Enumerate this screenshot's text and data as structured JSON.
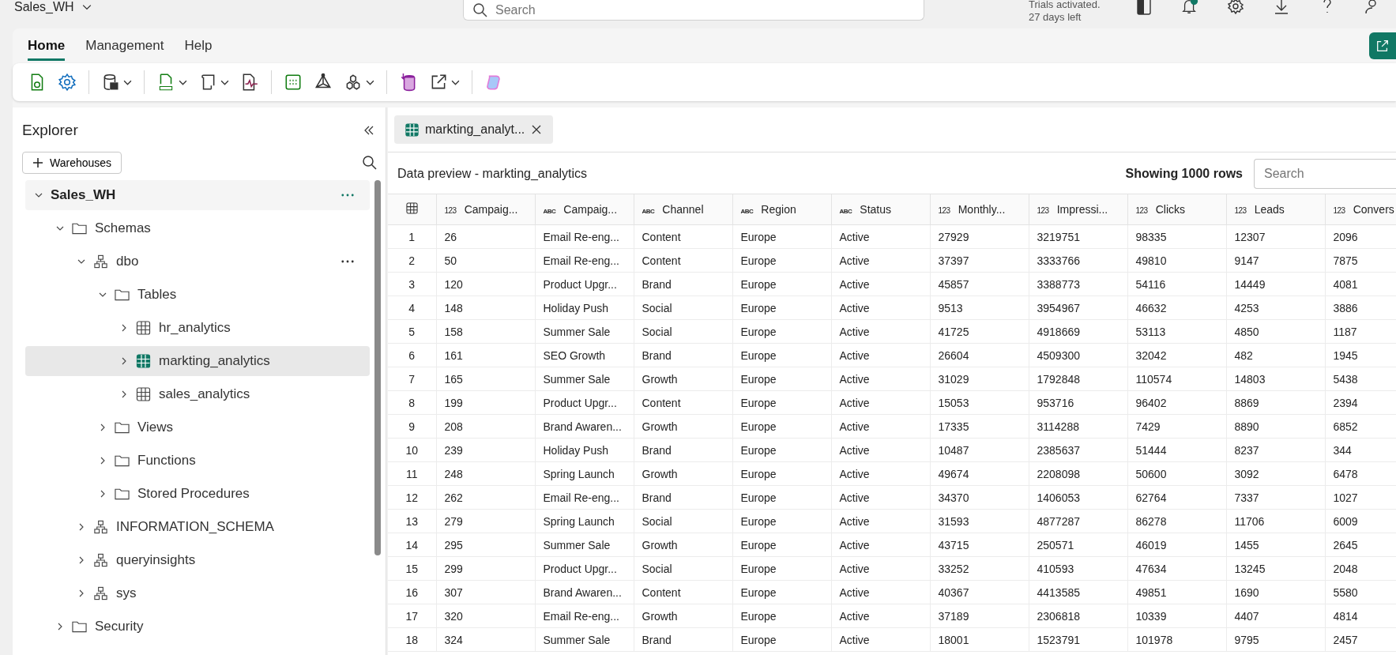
{
  "header": {
    "workspace": "Sales_WH",
    "search_placeholder": "Search",
    "trial_lines": [
      "Trials activated.",
      "27 days left"
    ],
    "notifications_badge": true
  },
  "ribbon_tabs": [
    {
      "label": "Home",
      "selected": true
    },
    {
      "label": "Management",
      "selected": false
    },
    {
      "label": "Help",
      "selected": false
    }
  ],
  "toolbar": [
    [
      {
        "kind": "refresh",
        "dropdown": false
      },
      {
        "kind": "settings",
        "dropdown": false
      }
    ],
    [
      {
        "kind": "database",
        "dropdown": true
      }
    ],
    [
      {
        "kind": "sql",
        "dropdown": true
      },
      {
        "kind": "script",
        "dropdown": true
      },
      {
        "kind": "report",
        "dropdown": false
      }
    ],
    [
      {
        "kind": "grid",
        "dropdown": false
      },
      {
        "kind": "model",
        "dropdown": false
      },
      {
        "kind": "shapes",
        "dropdown": true
      }
    ],
    [
      {
        "kind": "import",
        "dropdown": false
      },
      {
        "kind": "export",
        "dropdown": true
      }
    ],
    [
      {
        "kind": "copilot",
        "dropdown": false
      }
    ]
  ],
  "explorer": {
    "title": "Explorer",
    "add_button": "Warehouses",
    "tree": [
      {
        "label": "Sales_WH",
        "kind": "warehouse",
        "expanded": true,
        "selected": false,
        "menu": true,
        "children": [
          {
            "label": "Schemas",
            "kind": "folder",
            "expanded": true,
            "selected": false,
            "menu": false,
            "children": [
              {
                "label": "dbo",
                "kind": "schema",
                "expanded": true,
                "selected": false,
                "menu": true,
                "children": [
                  {
                    "label": "Tables",
                    "kind": "folder",
                    "expanded": true,
                    "selected": false,
                    "menu": false,
                    "children": [
                      {
                        "label": "hr_analytics",
                        "kind": "table",
                        "expanded": false,
                        "selected": false,
                        "menu": false
                      },
                      {
                        "label": "markting_analytics",
                        "kind": "table",
                        "expanded": false,
                        "selected": true,
                        "menu": false
                      },
                      {
                        "label": "sales_analytics",
                        "kind": "table",
                        "expanded": false,
                        "selected": false,
                        "menu": false
                      }
                    ]
                  },
                  {
                    "label": "Views",
                    "kind": "folder",
                    "expanded": false,
                    "selected": false,
                    "menu": false
                  },
                  {
                    "label": "Functions",
                    "kind": "folder",
                    "expanded": false,
                    "selected": false,
                    "menu": false
                  },
                  {
                    "label": "Stored Procedures",
                    "kind": "folder",
                    "expanded": false,
                    "selected": false,
                    "menu": false
                  }
                ]
              },
              {
                "label": "INFORMATION_SCHEMA",
                "kind": "schema",
                "expanded": false,
                "selected": false,
                "menu": false
              },
              {
                "label": "queryinsights",
                "kind": "schema",
                "expanded": false,
                "selected": false,
                "menu": false
              },
              {
                "label": "sys",
                "kind": "schema",
                "expanded": false,
                "selected": false,
                "menu": false
              }
            ]
          },
          {
            "label": "Security",
            "kind": "folder",
            "expanded": false,
            "selected": false,
            "menu": false
          }
        ]
      }
    ]
  },
  "editor_tabs": [
    {
      "label": "markting_analyt...",
      "selected": true
    }
  ],
  "preview": {
    "title": "Data preview - markting_analytics",
    "row_count": "Showing 1000 rows",
    "search_placeholder": "Search",
    "columns": [
      {
        "type": "123",
        "label": "Campaig..."
      },
      {
        "type": "ABC",
        "label": "Campaig..."
      },
      {
        "type": "ABC",
        "label": "Channel"
      },
      {
        "type": "ABC",
        "label": "Region"
      },
      {
        "type": "ABC",
        "label": "Status"
      },
      {
        "type": "123",
        "label": "Monthly..."
      },
      {
        "type": "123",
        "label": "Impressi..."
      },
      {
        "type": "123",
        "label": "Clicks"
      },
      {
        "type": "123",
        "label": "Leads"
      },
      {
        "type": "123",
        "label": "Convers"
      }
    ],
    "rows": [
      {
        "number": "1",
        "cells": [
          "26",
          "Email Re-eng...",
          "Content",
          "Europe",
          "Active",
          "27929",
          "3219751",
          "98335",
          "12307",
          "2096"
        ]
      },
      {
        "number": "2",
        "cells": [
          "50",
          "Email Re-eng...",
          "Content",
          "Europe",
          "Active",
          "37397",
          "3333766",
          "49810",
          "9147",
          "7875"
        ]
      },
      {
        "number": "3",
        "cells": [
          "120",
          "Product Upgr...",
          "Brand",
          "Europe",
          "Active",
          "45857",
          "3388773",
          "54116",
          "14449",
          "4081"
        ]
      },
      {
        "number": "4",
        "cells": [
          "148",
          "Holiday Push",
          "Social",
          "Europe",
          "Active",
          "9513",
          "3954967",
          "46632",
          "4253",
          "3886"
        ]
      },
      {
        "number": "5",
        "cells": [
          "158",
          "Summer Sale",
          "Social",
          "Europe",
          "Active",
          "41725",
          "4918669",
          "53113",
          "4850",
          "1187"
        ]
      },
      {
        "number": "6",
        "cells": [
          "161",
          "SEO Growth",
          "Brand",
          "Europe",
          "Active",
          "26604",
          "4509300",
          "32042",
          "482",
          "1945"
        ]
      },
      {
        "number": "7",
        "cells": [
          "165",
          "Summer Sale",
          "Growth",
          "Europe",
          "Active",
          "31029",
          "1792848",
          "110574",
          "14803",
          "5438"
        ]
      },
      {
        "number": "8",
        "cells": [
          "199",
          "Product Upgr...",
          "Content",
          "Europe",
          "Active",
          "15053",
          "953716",
          "96402",
          "8869",
          "2394"
        ]
      },
      {
        "number": "9",
        "cells": [
          "208",
          "Brand Awaren...",
          "Growth",
          "Europe",
          "Active",
          "17335",
          "3114288",
          "7429",
          "8890",
          "6852"
        ]
      },
      {
        "number": "10",
        "cells": [
          "239",
          "Holiday Push",
          "Brand",
          "Europe",
          "Active",
          "10487",
          "2385637",
          "51444",
          "8237",
          "344"
        ]
      },
      {
        "number": "11",
        "cells": [
          "248",
          "Spring Launch",
          "Growth",
          "Europe",
          "Active",
          "49674",
          "2208098",
          "50600",
          "3092",
          "6478"
        ]
      },
      {
        "number": "12",
        "cells": [
          "262",
          "Email Re-eng...",
          "Brand",
          "Europe",
          "Active",
          "34370",
          "1406053",
          "62764",
          "7337",
          "1027"
        ]
      },
      {
        "number": "13",
        "cells": [
          "279",
          "Spring Launch",
          "Social",
          "Europe",
          "Active",
          "31593",
          "4877287",
          "86278",
          "11706",
          "6009"
        ]
      },
      {
        "number": "14",
        "cells": [
          "295",
          "Summer Sale",
          "Growth",
          "Europe",
          "Active",
          "43715",
          "250571",
          "46019",
          "1455",
          "2645"
        ]
      },
      {
        "number": "15",
        "cells": [
          "299",
          "Product Upgr...",
          "Social",
          "Europe",
          "Active",
          "33252",
          "410593",
          "47634",
          "13245",
          "2048"
        ]
      },
      {
        "number": "16",
        "cells": [
          "307",
          "Brand Awaren...",
          "Content",
          "Europe",
          "Active",
          "40367",
          "4413585",
          "49851",
          "1690",
          "5580"
        ]
      },
      {
        "number": "17",
        "cells": [
          "320",
          "Email Re-eng...",
          "Growth",
          "Europe",
          "Active",
          "37189",
          "2306818",
          "10339",
          "4407",
          "4814"
        ]
      },
      {
        "number": "18",
        "cells": [
          "324",
          "Summer Sale",
          "Brand",
          "Europe",
          "Active",
          "18001",
          "1523791",
          "101978",
          "9795",
          "2457"
        ]
      }
    ]
  }
}
